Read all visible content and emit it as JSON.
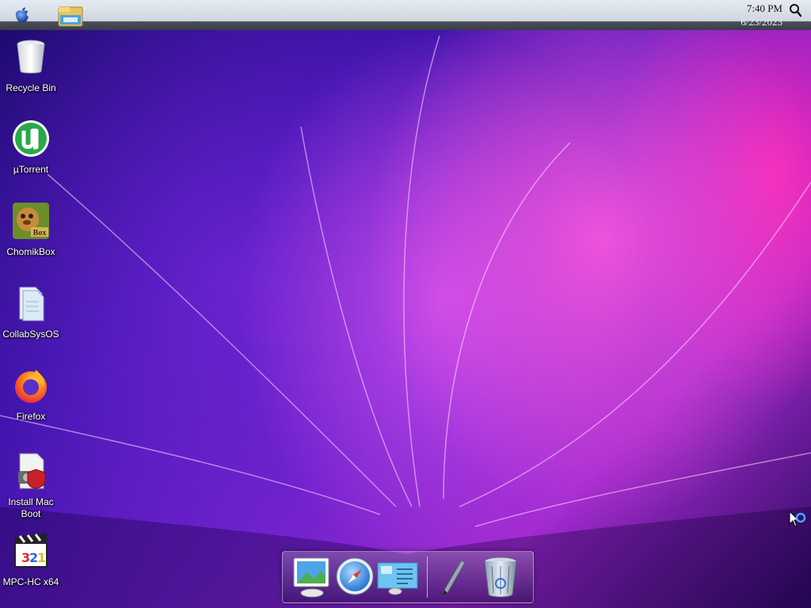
{
  "menubar": {
    "time": "7:40 PM",
    "date": "6/23/2023",
    "icons": [
      "apple-icon",
      "file-explorer-icon",
      "search-icon"
    ]
  },
  "desktop_icons": [
    {
      "label": "Recycle Bin",
      "icon": "recycle-bin-icon"
    },
    {
      "label": "µTorrent",
      "icon": "utorrent-icon"
    },
    {
      "label": "ChomikBox",
      "icon": "chomikbox-icon"
    },
    {
      "label": "CollabSysOS",
      "icon": "folder-icon"
    },
    {
      "label": "Firefox",
      "icon": "firefox-icon"
    },
    {
      "label": "Install Mac Boot",
      "icon": "installer-icon"
    },
    {
      "label": "MPC-HC x64",
      "icon": "mpc-hc-icon"
    }
  ],
  "dock": {
    "items": [
      "preview-icon",
      "safari-icon",
      "display-settings-icon",
      "pen-icon",
      "trash-icon"
    ]
  },
  "colors": {
    "menubar": "#dde3eb",
    "accent_pink": "#ff3ab8",
    "deep_purple": "#2a0a6e"
  }
}
